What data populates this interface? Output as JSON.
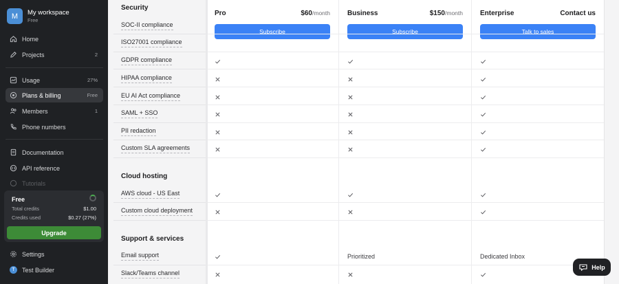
{
  "workspace": {
    "avatar_letter": "M",
    "name": "My workspace",
    "plan": "Free"
  },
  "nav": {
    "home": "Home",
    "projects": "Projects",
    "projects_count": "2",
    "usage": "Usage",
    "usage_pct": "27%",
    "plans": "Plans & billing",
    "plans_badge": "Free",
    "members": "Members",
    "members_count": "1",
    "phone": "Phone numbers",
    "docs": "Documentation",
    "api": "API reference",
    "tutorials": "Tutorials",
    "settings": "Settings",
    "user_initial": "T",
    "user": "Test Builder"
  },
  "credits": {
    "title": "Free",
    "total_label": "Total credits",
    "total_value": "$1.00",
    "used_label": "Credits used",
    "used_value": "$0.27 (27%)",
    "upgrade": "Upgrade"
  },
  "plans": {
    "pro": {
      "name": "Pro",
      "price": "$60",
      "per": "/month",
      "button": "Subscribe"
    },
    "business": {
      "name": "Business",
      "price": "$150",
      "per": "/month",
      "button": "Subscribe"
    },
    "enterprise": {
      "name": "Enterprise",
      "price": "Contact us",
      "button": "Talk to sales"
    }
  },
  "sections": {
    "security": "Security",
    "cloud": "Cloud hosting",
    "support": "Support & services"
  },
  "rows": [
    {
      "label": "SOC-II compliance",
      "pro": "",
      "business": "",
      "enterprise": ""
    },
    {
      "label": "ISO27001 compliance",
      "pro": "",
      "business": "",
      "enterprise": ""
    },
    {
      "label": "GDPR compliance",
      "pro": "check",
      "business": "check",
      "enterprise": "check"
    },
    {
      "label": "HIPAA compliance",
      "pro": "cross",
      "business": "cross",
      "enterprise": "check"
    },
    {
      "label": "EU AI Act compliance",
      "pro": "cross",
      "business": "cross",
      "enterprise": "check"
    },
    {
      "label": "SAML + SSO",
      "pro": "cross",
      "business": "cross",
      "enterprise": "check"
    },
    {
      "label": "PII redaction",
      "pro": "cross",
      "business": "cross",
      "enterprise": "check"
    },
    {
      "label": "Custom SLA agreements",
      "pro": "cross",
      "business": "cross",
      "enterprise": "check"
    },
    {
      "label": "AWS cloud - US East",
      "pro": "check",
      "business": "check",
      "enterprise": "check"
    },
    {
      "label": "Custom cloud deployment",
      "pro": "cross",
      "business": "cross",
      "enterprise": "check"
    },
    {
      "label": "Email support",
      "pro": "check",
      "business": "Prioritized",
      "enterprise": "Dedicated Inbox"
    },
    {
      "label": "Slack/Teams channel",
      "pro": "cross",
      "business": "cross",
      "enterprise": "check"
    }
  ],
  "help": "Help"
}
